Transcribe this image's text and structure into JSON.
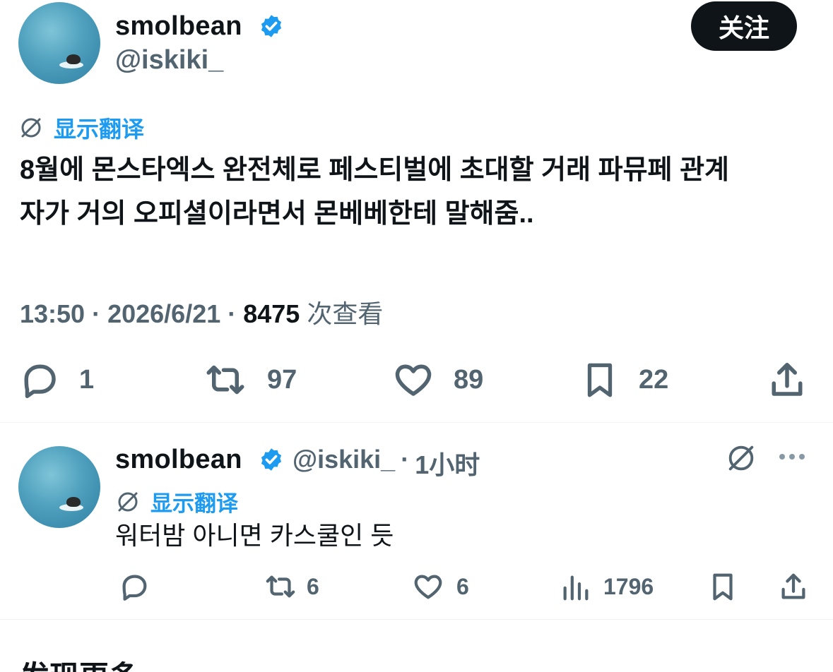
{
  "tweet": {
    "author_name": "smolbean",
    "author_handle": "@iskiki_",
    "follow_label": "关注",
    "translate_label": "显示翻译",
    "text_line1": "8월에 몬스타엑스 완전체로 페스티벌에 초대할 거래 파뮤페 관계",
    "text_line2": "자가 거의 오피셜이라면서 몬베베한테 말해줌..",
    "time": "13:50",
    "date": "2026/6/21",
    "separator": "·",
    "views_count": "8475",
    "views_label": "次查看",
    "replies": "1",
    "retweets": "97",
    "likes": "89",
    "bookmarks": "22"
  },
  "reply": {
    "author_name": "smolbean",
    "author_handle": "@iskiki_",
    "separator": "·",
    "time_ago": "1小时",
    "translate_label": "显示翻译",
    "text": "워터밤 아니면 카스쿨인 듯",
    "retweets": "6",
    "likes": "6",
    "views": "1796"
  },
  "discover_label": "发现更多",
  "colors": {
    "accent": "#1d9bf0",
    "secondary_text": "#536471",
    "primary_text": "#0f1419",
    "follow_bg": "#0f1419"
  }
}
